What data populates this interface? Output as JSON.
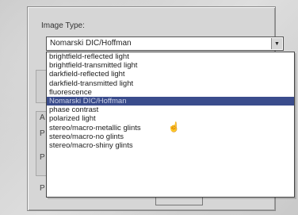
{
  "image_type": {
    "label": "Image Type:",
    "selected_value": "Nomarski DIC/Hoffman",
    "options": [
      "brightfield-reflected light",
      "brightfield-transmitted light",
      "darkfield-reflected light",
      "darkfield-transmitted light",
      "fluorescence",
      "Nomarski DIC/Hoffman",
      "phase contrast",
      "polarized light",
      "stereo/macro-metallic glints",
      "stereo/macro-no glints",
      "stereo/macro-shiny glints"
    ],
    "highlighted_index": 5,
    "dropdown_icon": "chevron-down-icon"
  },
  "background_letters": [
    "A",
    "P",
    "P",
    "P"
  ],
  "colors": {
    "highlight": "#3a4c8c",
    "panel": "#d6d6d6"
  }
}
